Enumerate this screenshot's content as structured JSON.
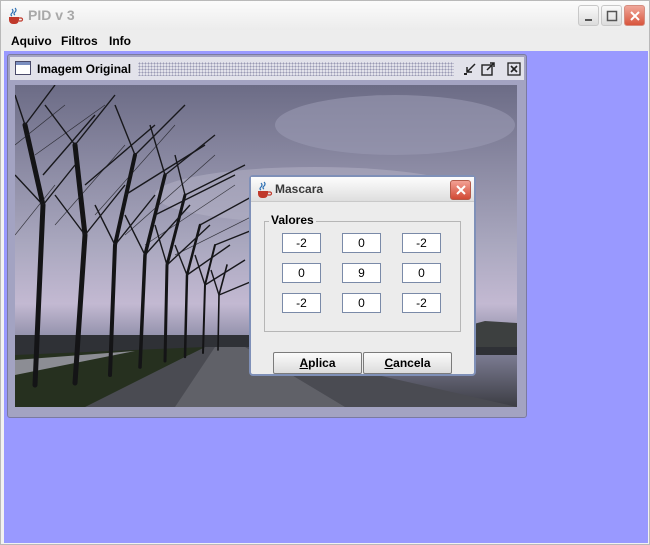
{
  "window": {
    "title": "PID v 3"
  },
  "menu": [
    "Aquivo",
    "Filtros",
    "Info"
  ],
  "internal_frame": {
    "title": "Imagem Original"
  },
  "dialog": {
    "title": "Mascara",
    "group_label": "Valores",
    "matrix": [
      [
        "-2",
        "0",
        "-2"
      ],
      [
        "0",
        "9",
        "0"
      ],
      [
        "-2",
        "0",
        "-2"
      ]
    ],
    "apply_label_first": "A",
    "apply_label_rest": "plica",
    "cancel_label_first": "C",
    "cancel_label_rest": "ancela"
  },
  "colors": {
    "desktop": "#9999ff",
    "close_red": "#d24a35"
  }
}
